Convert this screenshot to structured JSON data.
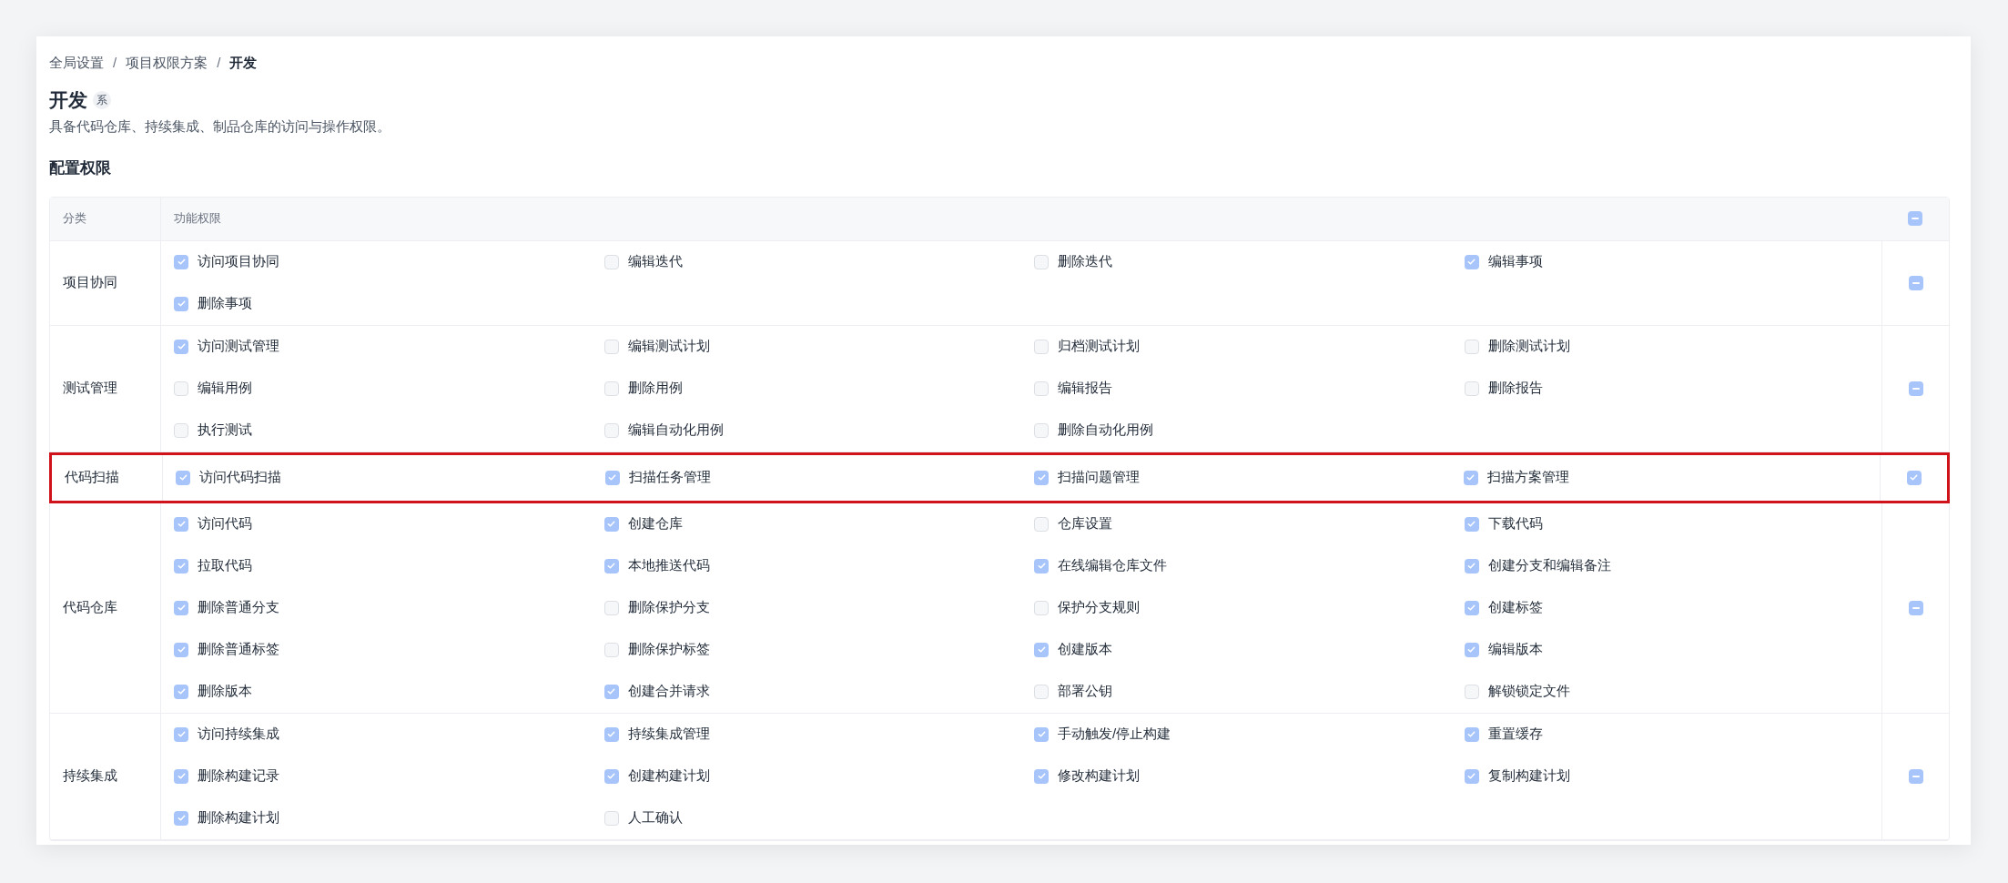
{
  "breadcrumb": [
    {
      "label": "全局设置",
      "current": false
    },
    {
      "label": "项目权限方案",
      "current": false
    },
    {
      "label": "开发",
      "current": true
    }
  ],
  "breadcrumb_separator": "/",
  "title": "开发",
  "title_badge": "系",
  "description": "具备代码仓库、持续集成、制品仓库的访问与操作权限。",
  "section_title": "配置权限",
  "table": {
    "columns": [
      "分类",
      "功能权限"
    ],
    "header_select_all": {
      "indeterminate": true
    },
    "rows": [
      {
        "category": "项目协同",
        "highlighted": false,
        "select_all": {
          "indeterminate": true
        },
        "permissions": [
          {
            "label": "访问项目协同",
            "checked": true
          },
          {
            "label": "编辑迭代",
            "checked": false
          },
          {
            "label": "删除迭代",
            "checked": false
          },
          {
            "label": "编辑事项",
            "checked": true
          },
          {
            "label": "删除事项",
            "checked": true
          }
        ]
      },
      {
        "category": "测试管理",
        "highlighted": false,
        "select_all": {
          "indeterminate": true
        },
        "permissions": [
          {
            "label": "访问测试管理",
            "checked": true
          },
          {
            "label": "编辑测试计划",
            "checked": false
          },
          {
            "label": "归档测试计划",
            "checked": false
          },
          {
            "label": "删除测试计划",
            "checked": false
          },
          {
            "label": "编辑用例",
            "checked": false
          },
          {
            "label": "删除用例",
            "checked": false
          },
          {
            "label": "编辑报告",
            "checked": false
          },
          {
            "label": "删除报告",
            "checked": false
          },
          {
            "label": "执行测试",
            "checked": false
          },
          {
            "label": "编辑自动化用例",
            "checked": false
          },
          {
            "label": "删除自动化用例",
            "checked": false
          }
        ]
      },
      {
        "category": "代码扫描",
        "highlighted": true,
        "select_all": {
          "checked": true
        },
        "permissions": [
          {
            "label": "访问代码扫描",
            "checked": true
          },
          {
            "label": "扫描任务管理",
            "checked": true
          },
          {
            "label": "扫描问题管理",
            "checked": true
          },
          {
            "label": "扫描方案管理",
            "checked": true
          }
        ]
      },
      {
        "category": "代码仓库",
        "highlighted": false,
        "select_all": {
          "indeterminate": true
        },
        "permissions": [
          {
            "label": "访问代码",
            "checked": true
          },
          {
            "label": "创建仓库",
            "checked": true
          },
          {
            "label": "仓库设置",
            "checked": false
          },
          {
            "label": "下载代码",
            "checked": true
          },
          {
            "label": "拉取代码",
            "checked": true
          },
          {
            "label": "本地推送代码",
            "checked": true
          },
          {
            "label": "在线编辑仓库文件",
            "checked": true
          },
          {
            "label": "创建分支和编辑备注",
            "checked": true
          },
          {
            "label": "删除普通分支",
            "checked": true
          },
          {
            "label": "删除保护分支",
            "checked": false
          },
          {
            "label": "保护分支规则",
            "checked": false
          },
          {
            "label": "创建标签",
            "checked": true
          },
          {
            "label": "删除普通标签",
            "checked": true
          },
          {
            "label": "删除保护标签",
            "checked": false
          },
          {
            "label": "创建版本",
            "checked": true
          },
          {
            "label": "编辑版本",
            "checked": true
          },
          {
            "label": "删除版本",
            "checked": true
          },
          {
            "label": "创建合并请求",
            "checked": true
          },
          {
            "label": "部署公钥",
            "checked": false
          },
          {
            "label": "解锁锁定文件",
            "checked": false
          }
        ]
      },
      {
        "category": "持续集成",
        "highlighted": false,
        "select_all": {
          "indeterminate": true
        },
        "permissions": [
          {
            "label": "访问持续集成",
            "checked": true
          },
          {
            "label": "持续集成管理",
            "checked": true
          },
          {
            "label": "手动触发/停止构建",
            "checked": true
          },
          {
            "label": "重置缓存",
            "checked": true
          },
          {
            "label": "删除构建记录",
            "checked": true
          },
          {
            "label": "创建构建计划",
            "checked": true
          },
          {
            "label": "修改构建计划",
            "checked": true
          },
          {
            "label": "复制构建计划",
            "checked": true
          },
          {
            "label": "删除构建计划",
            "checked": true
          },
          {
            "label": "人工确认",
            "checked": false
          }
        ]
      }
    ]
  }
}
